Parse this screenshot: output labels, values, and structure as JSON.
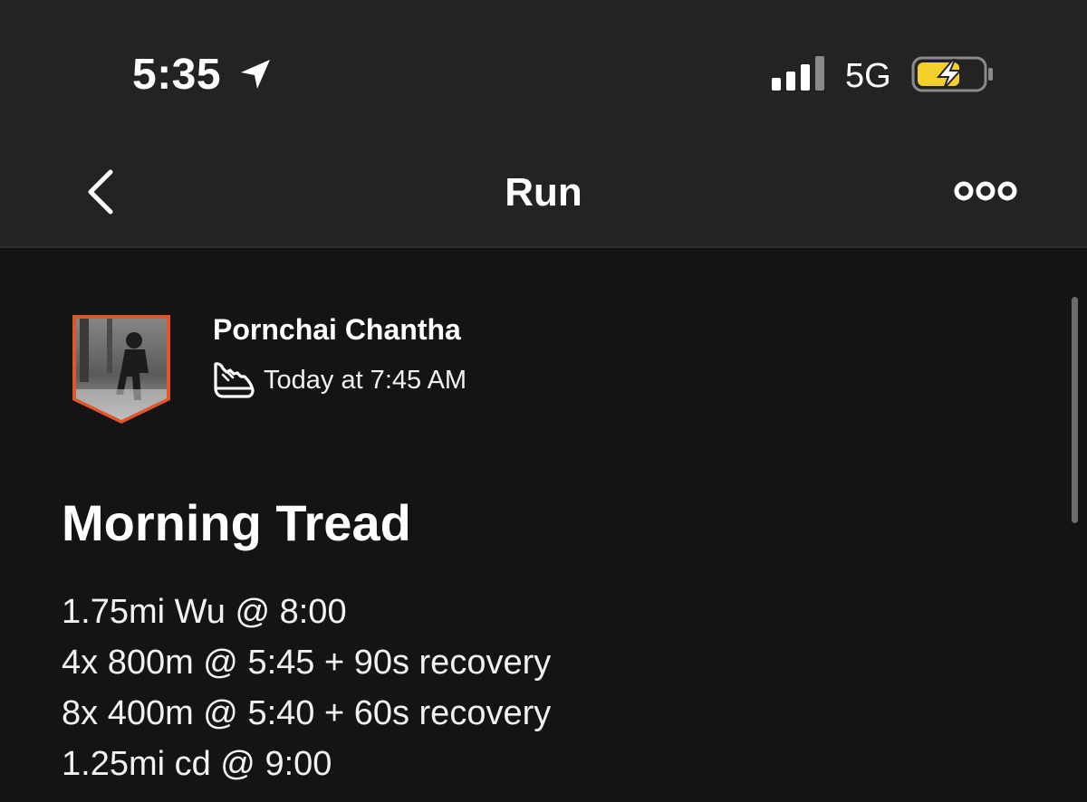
{
  "status_bar": {
    "time": "5:35",
    "network": "5G"
  },
  "nav": {
    "title": "Run"
  },
  "activity": {
    "athlete_name": "Pornchai Chantha",
    "time": "Today at 7:45 AM",
    "title": "Morning Tread",
    "description_lines": [
      "1.75mi Wu @ 8:00",
      "4x 800m @ 5:45 + 90s recovery",
      "8x 400m @ 5:40 + 60s recovery",
      "1.25mi cd @ 9:00"
    ]
  },
  "colors": {
    "accent_orange": "#e0552a",
    "battery_yellow": "#f5cf2a"
  }
}
